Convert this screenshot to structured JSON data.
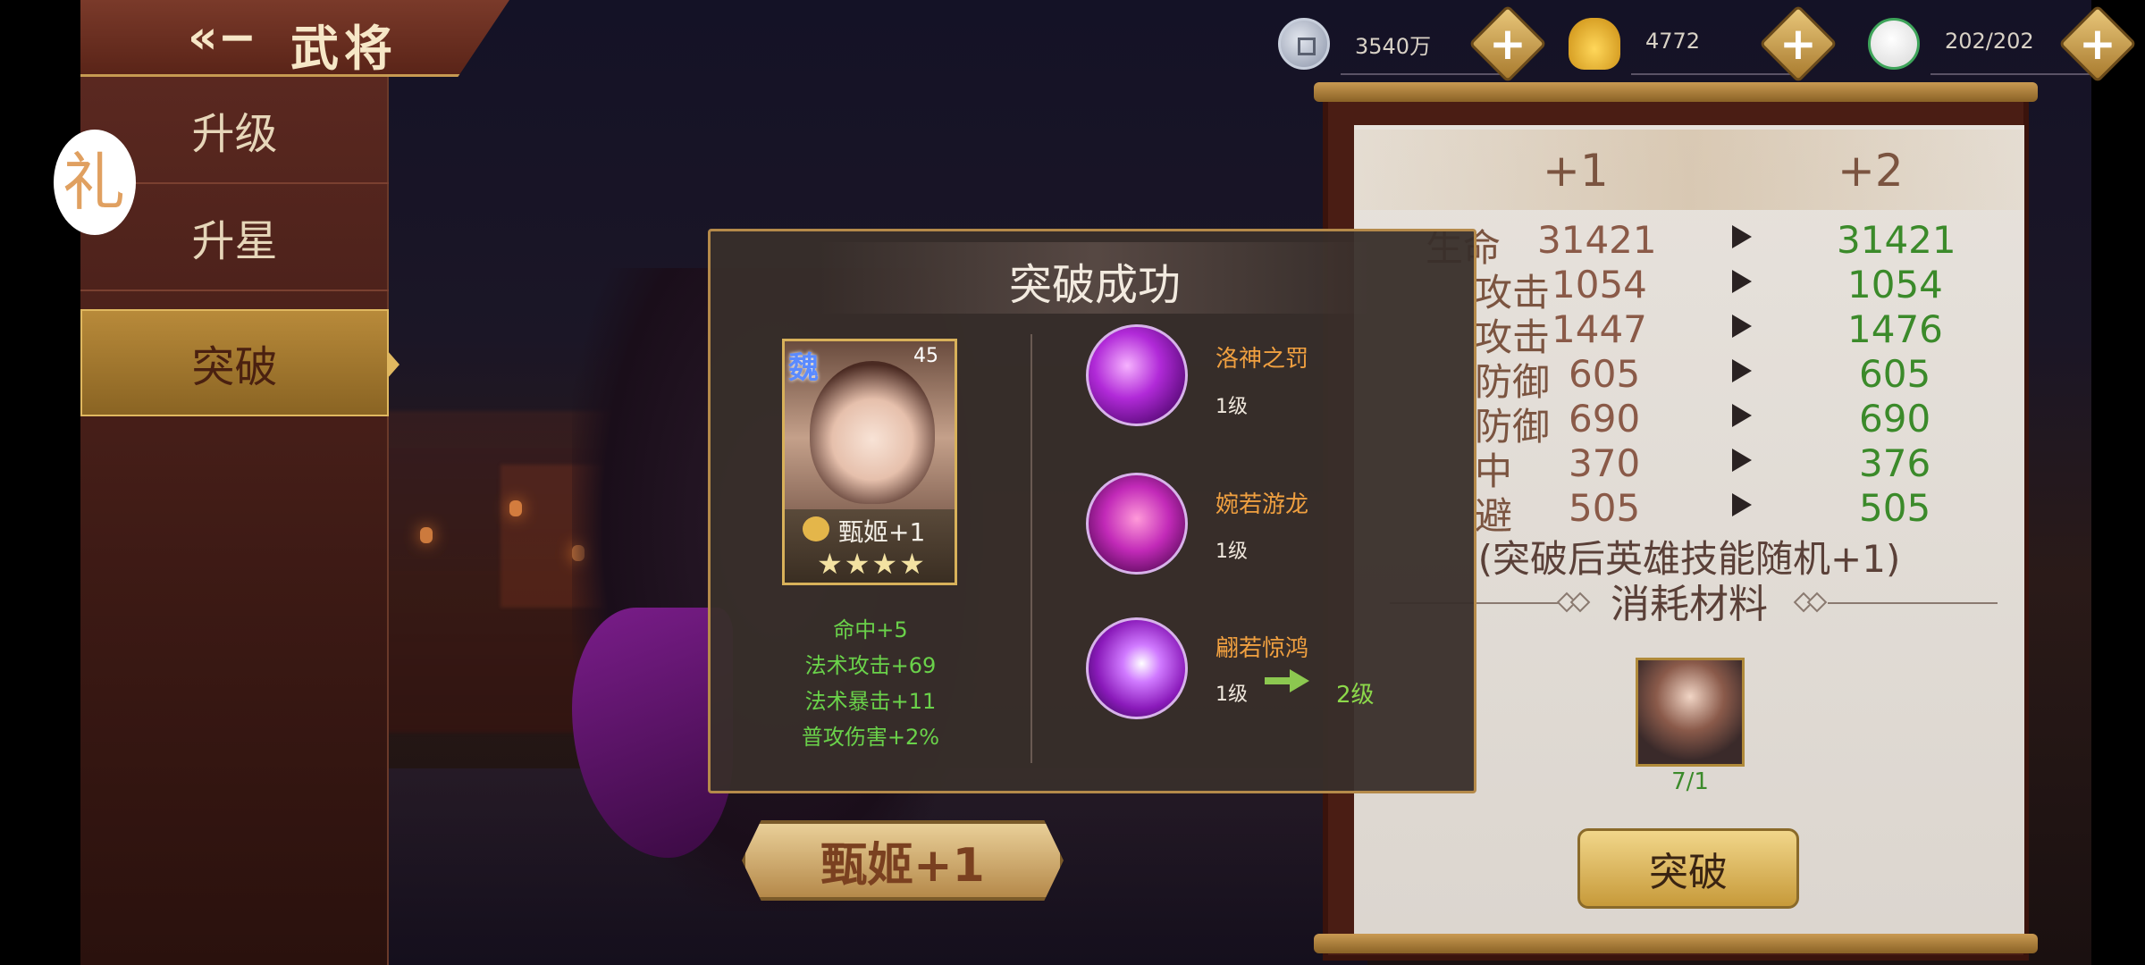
{
  "header": {
    "title": "武将"
  },
  "side_tab": {
    "glyph": "礼"
  },
  "nav": {
    "items": [
      "升级",
      "升星",
      "突破"
    ],
    "active": "突破"
  },
  "resources": [
    {
      "icon": "silver-coin-icon",
      "value": "3540万"
    },
    {
      "icon": "gold-ingot-icon",
      "value": "4772"
    },
    {
      "icon": "bun-stamina-icon",
      "value": "202/202"
    }
  ],
  "panel": {
    "col_from": "+1",
    "col_to": "+2",
    "stats": [
      {
        "label": "生命",
        "from": "31421",
        "to": "31421"
      },
      {
        "label": "攻击",
        "from": "1054",
        "to": "1054"
      },
      {
        "label": "攻击",
        "from": "1447",
        "to": "1476"
      },
      {
        "label": "防御",
        "from": "605",
        "to": "605"
      },
      {
        "label": "防御",
        "from": "690",
        "to": "690"
      },
      {
        "label": "中",
        "from": "370",
        "to": "376"
      },
      {
        "label": "避",
        "from": "505",
        "to": "505"
      }
    ],
    "skill_note": "(突破后英雄技能随机+1)",
    "materials_title": "消耗材料",
    "material_count": "7/1",
    "break_button": "突破"
  },
  "hero_plate": "甄姬+1",
  "popup": {
    "title": "突破成功",
    "hero": {
      "faction": "魏",
      "level": "45",
      "name": "甄姬+1",
      "stars": "★★★★"
    },
    "bonuses": [
      "命中+5",
      "法术攻击+69",
      "法术暴击+11",
      "普攻伤害+2%"
    ],
    "skills": [
      {
        "name": "洛神之罚",
        "level": "1级"
      },
      {
        "name": "婉若游龙",
        "level": "1级"
      },
      {
        "name": "翩若惊鸿",
        "level": "1级",
        "new_level": "2级"
      }
    ]
  }
}
